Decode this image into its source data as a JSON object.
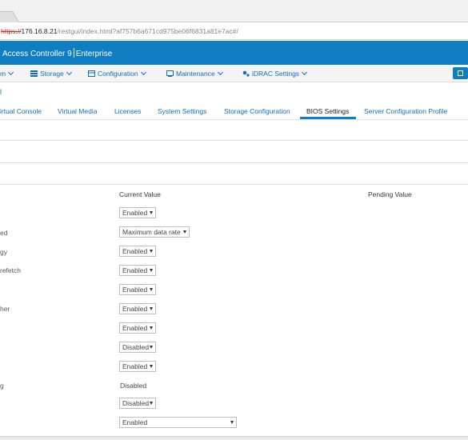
{
  "browser": {
    "url_scheme": "https://",
    "url_host": "176.16.8.21",
    "url_path": "/restgui/index.html?af757b6a671cd975be06f6831a81e7ac#/"
  },
  "app": {
    "title_product": "Access Controller 9",
    "title_edition": "Enterprise"
  },
  "mainnav": {
    "items": [
      {
        "label": "m",
        "icon": "chevron-down-icon"
      },
      {
        "label": "Storage",
        "icon": "storage-icon"
      },
      {
        "label": "Configuration",
        "icon": "configuration-icon"
      },
      {
        "label": "Maintenance",
        "icon": "maintenance-icon"
      },
      {
        "label": "iDRAC Settings",
        "icon": "settings-icon"
      }
    ],
    "right_button_icon": "window-icon"
  },
  "subnav": {
    "crumb": "l",
    "tabs": [
      {
        "label": "irtual Console"
      },
      {
        "label": "Virtual Media"
      },
      {
        "label": "Licenses"
      },
      {
        "label": "System Settings"
      },
      {
        "label": "Storage Configuration"
      },
      {
        "label": "BIOS Settings",
        "active": true
      },
      {
        "label": "Server Configuration Profile"
      }
    ]
  },
  "table": {
    "col_current": "Current Value",
    "col_pending": "Pending Value",
    "rows": [
      {
        "label": "",
        "value": "Enabled",
        "control": "dropdown"
      },
      {
        "label": "ed",
        "value": "Maximum data rate",
        "control": "dropdown"
      },
      {
        "label": "gy",
        "value": "Enabled",
        "control": "dropdown"
      },
      {
        "label": "refetch",
        "value": "Enabled",
        "control": "dropdown"
      },
      {
        "label": "",
        "value": "Enabled",
        "control": "dropdown"
      },
      {
        "label": "her",
        "value": "Enabled",
        "control": "dropdown"
      },
      {
        "label": "",
        "value": "Enabled",
        "control": "dropdown"
      },
      {
        "label": "",
        "value": "Disabled",
        "control": "dropdown"
      },
      {
        "label": "",
        "value": "Enabled",
        "control": "dropdown"
      },
      {
        "label": "g",
        "value": "Disabled",
        "control": "static"
      },
      {
        "label": "",
        "value": "Disabled",
        "control": "dropdown"
      },
      {
        "label": "",
        "value": "Enabled",
        "control": "dropdown"
      }
    ]
  }
}
